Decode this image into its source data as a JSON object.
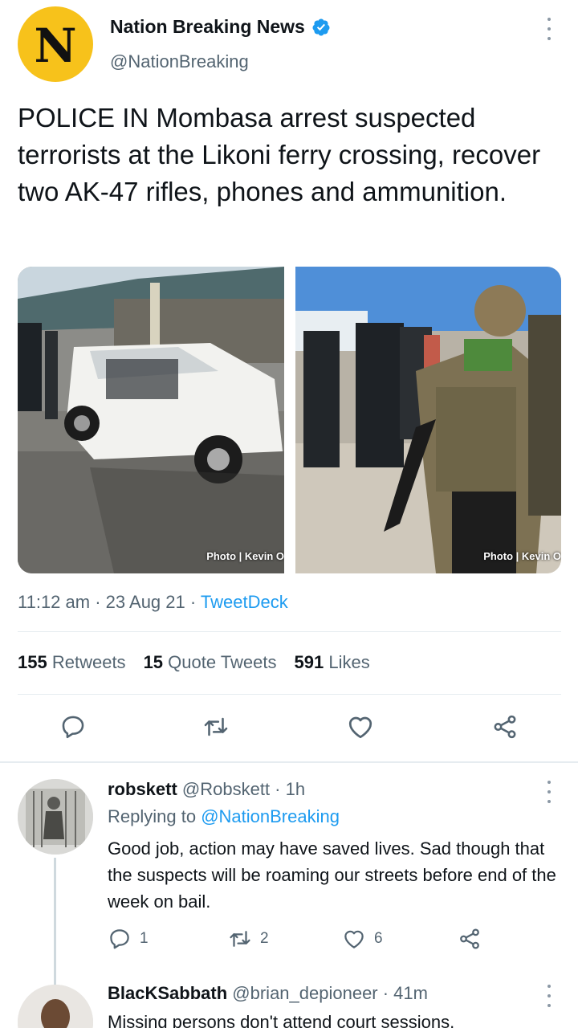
{
  "tweet": {
    "avatar_letter": "N",
    "author_name": "Nation Breaking News",
    "author_handle": "@NationBreaking",
    "text": "POLICE IN Mombasa arrest suspected terrorists at the Likoni ferry crossing, recover two AK-47 rifles, phones and ammunition.",
    "photos": [
      {
        "credit": "Photo | Kevin O"
      },
      {
        "credit": "Photo | Kevin O"
      }
    ],
    "time": "11:12 am · 23 Aug 21 · ",
    "source": "TweetDeck",
    "stats": {
      "retweets_count": "155",
      "retweets_label": "Retweets",
      "quotes_count": "15",
      "quotes_label": "Quote Tweets",
      "likes_count": "591",
      "likes_label": "Likes"
    }
  },
  "replies": [
    {
      "name": "robskett",
      "handle": "@Robskett · 1h",
      "replying_prefix": "Replying to ",
      "replying_to": "@NationBreaking",
      "text": "Good job, action may have saved lives. Sad though that the suspects will be roaming our streets before end of the week on bail.",
      "reply_count": "1",
      "retweet_count": "2",
      "like_count": "6"
    },
    {
      "name": "BlacKSabbath",
      "handle": "@brian_depioneer · 41m",
      "text": "Missing persons don't attend court sessions."
    }
  ],
  "colors": {
    "accent": "#1d9bf0",
    "avatar_bg": "#f7c21b",
    "muted_text": "#536471"
  },
  "icons": [
    "verified-badge-icon",
    "more-vert-icon",
    "reply-icon",
    "retweet-icon",
    "like-icon",
    "share-icon"
  ]
}
